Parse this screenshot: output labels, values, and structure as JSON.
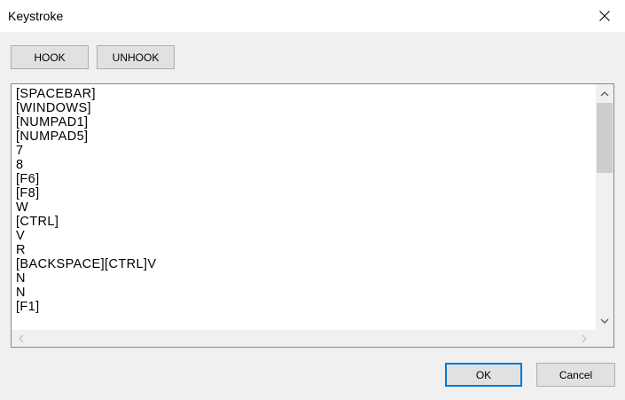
{
  "window": {
    "title": "Keystroke"
  },
  "toolbar": {
    "hook_label": "HOOK",
    "unhook_label": "UNHOOK"
  },
  "log": {
    "lines": [
      "[SPACEBAR]",
      "[WINDOWS]",
      "[NUMPAD1]",
      "[NUMPAD5]",
      "7",
      "8",
      "[F6]",
      "[F8]",
      "W",
      "[CTRL]",
      "V",
      "R",
      "[BACKSPACE][CTRL]V",
      "N",
      "N",
      "[F1]"
    ]
  },
  "footer": {
    "ok_label": "OK",
    "cancel_label": "Cancel"
  },
  "icons": {
    "close": "close-icon",
    "scroll_up": "chevron-up-icon",
    "scroll_down": "chevron-down-icon",
    "scroll_left": "chevron-left-icon",
    "scroll_right": "chevron-right-icon"
  },
  "colors": {
    "window_bg": "#f0f0f0",
    "titlebar_bg": "#ffffff",
    "button_bg": "#e1e1e1",
    "button_border": "#adadad",
    "default_button_border": "#0078d7",
    "listbox_border": "#828790",
    "scroll_thumb": "#cdcdcd"
  }
}
